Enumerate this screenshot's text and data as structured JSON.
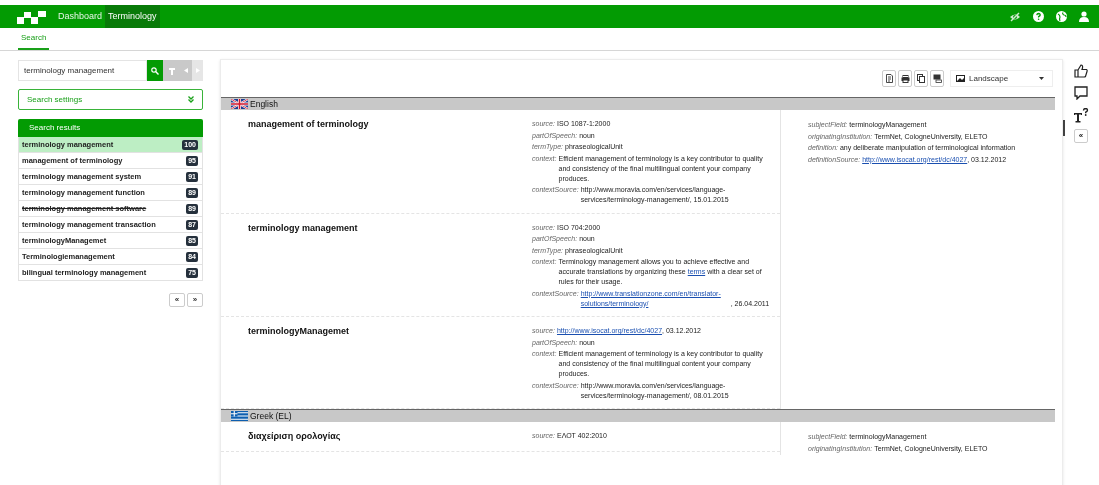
{
  "nav": [
    {
      "label": "Dashboard",
      "selected": false
    },
    {
      "label": "Terminology",
      "selected": true
    }
  ],
  "subnav": [
    {
      "label": "Search",
      "selected": true
    }
  ],
  "search": {
    "value": "terminology management",
    "settings_label": "Search settings"
  },
  "results": {
    "title": "Search results",
    "items": [
      {
        "label": "terminology management",
        "score": "100",
        "selected": true,
        "deprecated": false
      },
      {
        "label": "management of terminology",
        "score": "95",
        "selected": false,
        "deprecated": false
      },
      {
        "label": "terminology management system",
        "score": "91",
        "selected": false,
        "deprecated": false
      },
      {
        "label": "terminology management function",
        "score": "89",
        "selected": false,
        "deprecated": false
      },
      {
        "label": "terminology management software",
        "score": "89",
        "selected": false,
        "deprecated": true
      },
      {
        "label": "terminology management transaction",
        "score": "87",
        "selected": false,
        "deprecated": false
      },
      {
        "label": "terminologyManagemet",
        "score": "85",
        "selected": false,
        "deprecated": false
      },
      {
        "label": "Terminologiemanagement",
        "score": "84",
        "selected": false,
        "deprecated": false
      },
      {
        "label": "bilingual terminology management",
        "score": "75",
        "selected": false,
        "deprecated": false
      }
    ],
    "pager": [
      "«",
      "»"
    ]
  },
  "toolbar": {
    "orientation": "Landscape"
  },
  "side_collapse": "«",
  "languages": [
    {
      "name": "English",
      "kind": "uk",
      "terms": [
        {
          "term": "management of terminology",
          "fields": [
            {
              "label": "source:",
              "value": [
                {
                  "text": "ISO 1087-1:2000",
                  "link": false
                }
              ]
            },
            {
              "label": "partOfSpeech:",
              "value": [
                {
                  "text": "noun",
                  "link": false
                }
              ]
            },
            {
              "label": "termType:",
              "value": [
                {
                  "text": "phraseologicalUnit",
                  "link": false
                }
              ]
            },
            {
              "label": "context:",
              "value": [
                {
                  "text": "Efficient management of terminology is a key contributor to quality and consistency of the final multilingual content your company produces.",
                  "link": false
                }
              ]
            },
            {
              "label": "contextSource:",
              "value": [
                {
                  "text": "http://www.moravia.com/en/services/language-services/terminology-management/, 15.01.2015",
                  "link": false
                }
              ]
            }
          ]
        },
        {
          "term": "terminology management",
          "fields": [
            {
              "label": "source:",
              "value": [
                {
                  "text": "ISO 704:2000",
                  "link": false
                }
              ]
            },
            {
              "label": "partOfSpeech:",
              "value": [
                {
                  "text": "noun",
                  "link": false
                }
              ]
            },
            {
              "label": "termType:",
              "value": [
                {
                  "text": "phraseologicalUnit",
                  "link": false
                }
              ]
            },
            {
              "label": "context:",
              "value": [
                {
                  "text": "Terminology management allows you to achieve effective and accurate translations by organizing these ",
                  "link": false
                },
                {
                  "text": "terms",
                  "link": true
                },
                {
                  "text": " with a clear set of rules for their usage.",
                  "link": false
                }
              ]
            },
            {
              "label": "contextSource:",
              "value": [
                {
                  "text": "http://www.translationzone.com/en/translator-solutions/terminology/",
                  "link": true
                },
                {
                  "text": ", 26.04.2011",
                  "link": false
                }
              ]
            }
          ]
        },
        {
          "term": "terminologyManagemet",
          "fields": [
            {
              "label": "source:",
              "value": [
                {
                  "text": "http://www.isocat.org/rest/dc/4027",
                  "link": true
                },
                {
                  "text": ", 03.12.2012",
                  "link": false
                }
              ]
            },
            {
              "label": "partOfSpeech:",
              "value": [
                {
                  "text": "noun",
                  "link": false
                }
              ]
            },
            {
              "label": "context:",
              "value": [
                {
                  "text": "Efficient management of terminology is a key contributor to quality and consistency of the final multilingual content your company produces.",
                  "link": false
                }
              ]
            },
            {
              "label": "contextSource:",
              "value": [
                {
                  "text": "http://www.moravia.com/en/services/language-services/terminology-management/, 08.01.2015",
                  "link": false
                }
              ]
            }
          ]
        }
      ],
      "concept": [
        {
          "label": "subjectField:",
          "value": [
            {
              "text": "terminologyManagement",
              "link": false
            }
          ]
        },
        {
          "label": "originatingInstitution:",
          "value": [
            {
              "text": "TermNet, CologneUniversity, ELETO",
              "link": false
            }
          ]
        },
        {
          "label": "definition:",
          "value": [
            {
              "text": "any deliberate manipulation of terminological information",
              "link": false
            }
          ]
        },
        {
          "label": "definitionSource:",
          "value": [
            {
              "text": "http://www.isocat.org/rest/dc/4027",
              "link": true
            },
            {
              "text": ", 03.12.2012",
              "link": false
            }
          ]
        }
      ]
    },
    {
      "name": "Greek (EL)",
      "kind": "greece",
      "terms": [
        {
          "term": "διαχείριση ορολογίας",
          "fields": [
            {
              "label": "source:",
              "value": [
                {
                  "text": "ΕΛΟΤ 402:2010",
                  "link": false
                }
              ]
            }
          ]
        }
      ],
      "concept": [
        {
          "label": "subjectField:",
          "value": [
            {
              "text": "terminologyManagement",
              "link": false
            }
          ]
        },
        {
          "label": "originatingInstitution:",
          "value": [
            {
              "text": "TermNet, CologneUniversity, ELETO",
              "link": false
            }
          ]
        }
      ]
    }
  ]
}
